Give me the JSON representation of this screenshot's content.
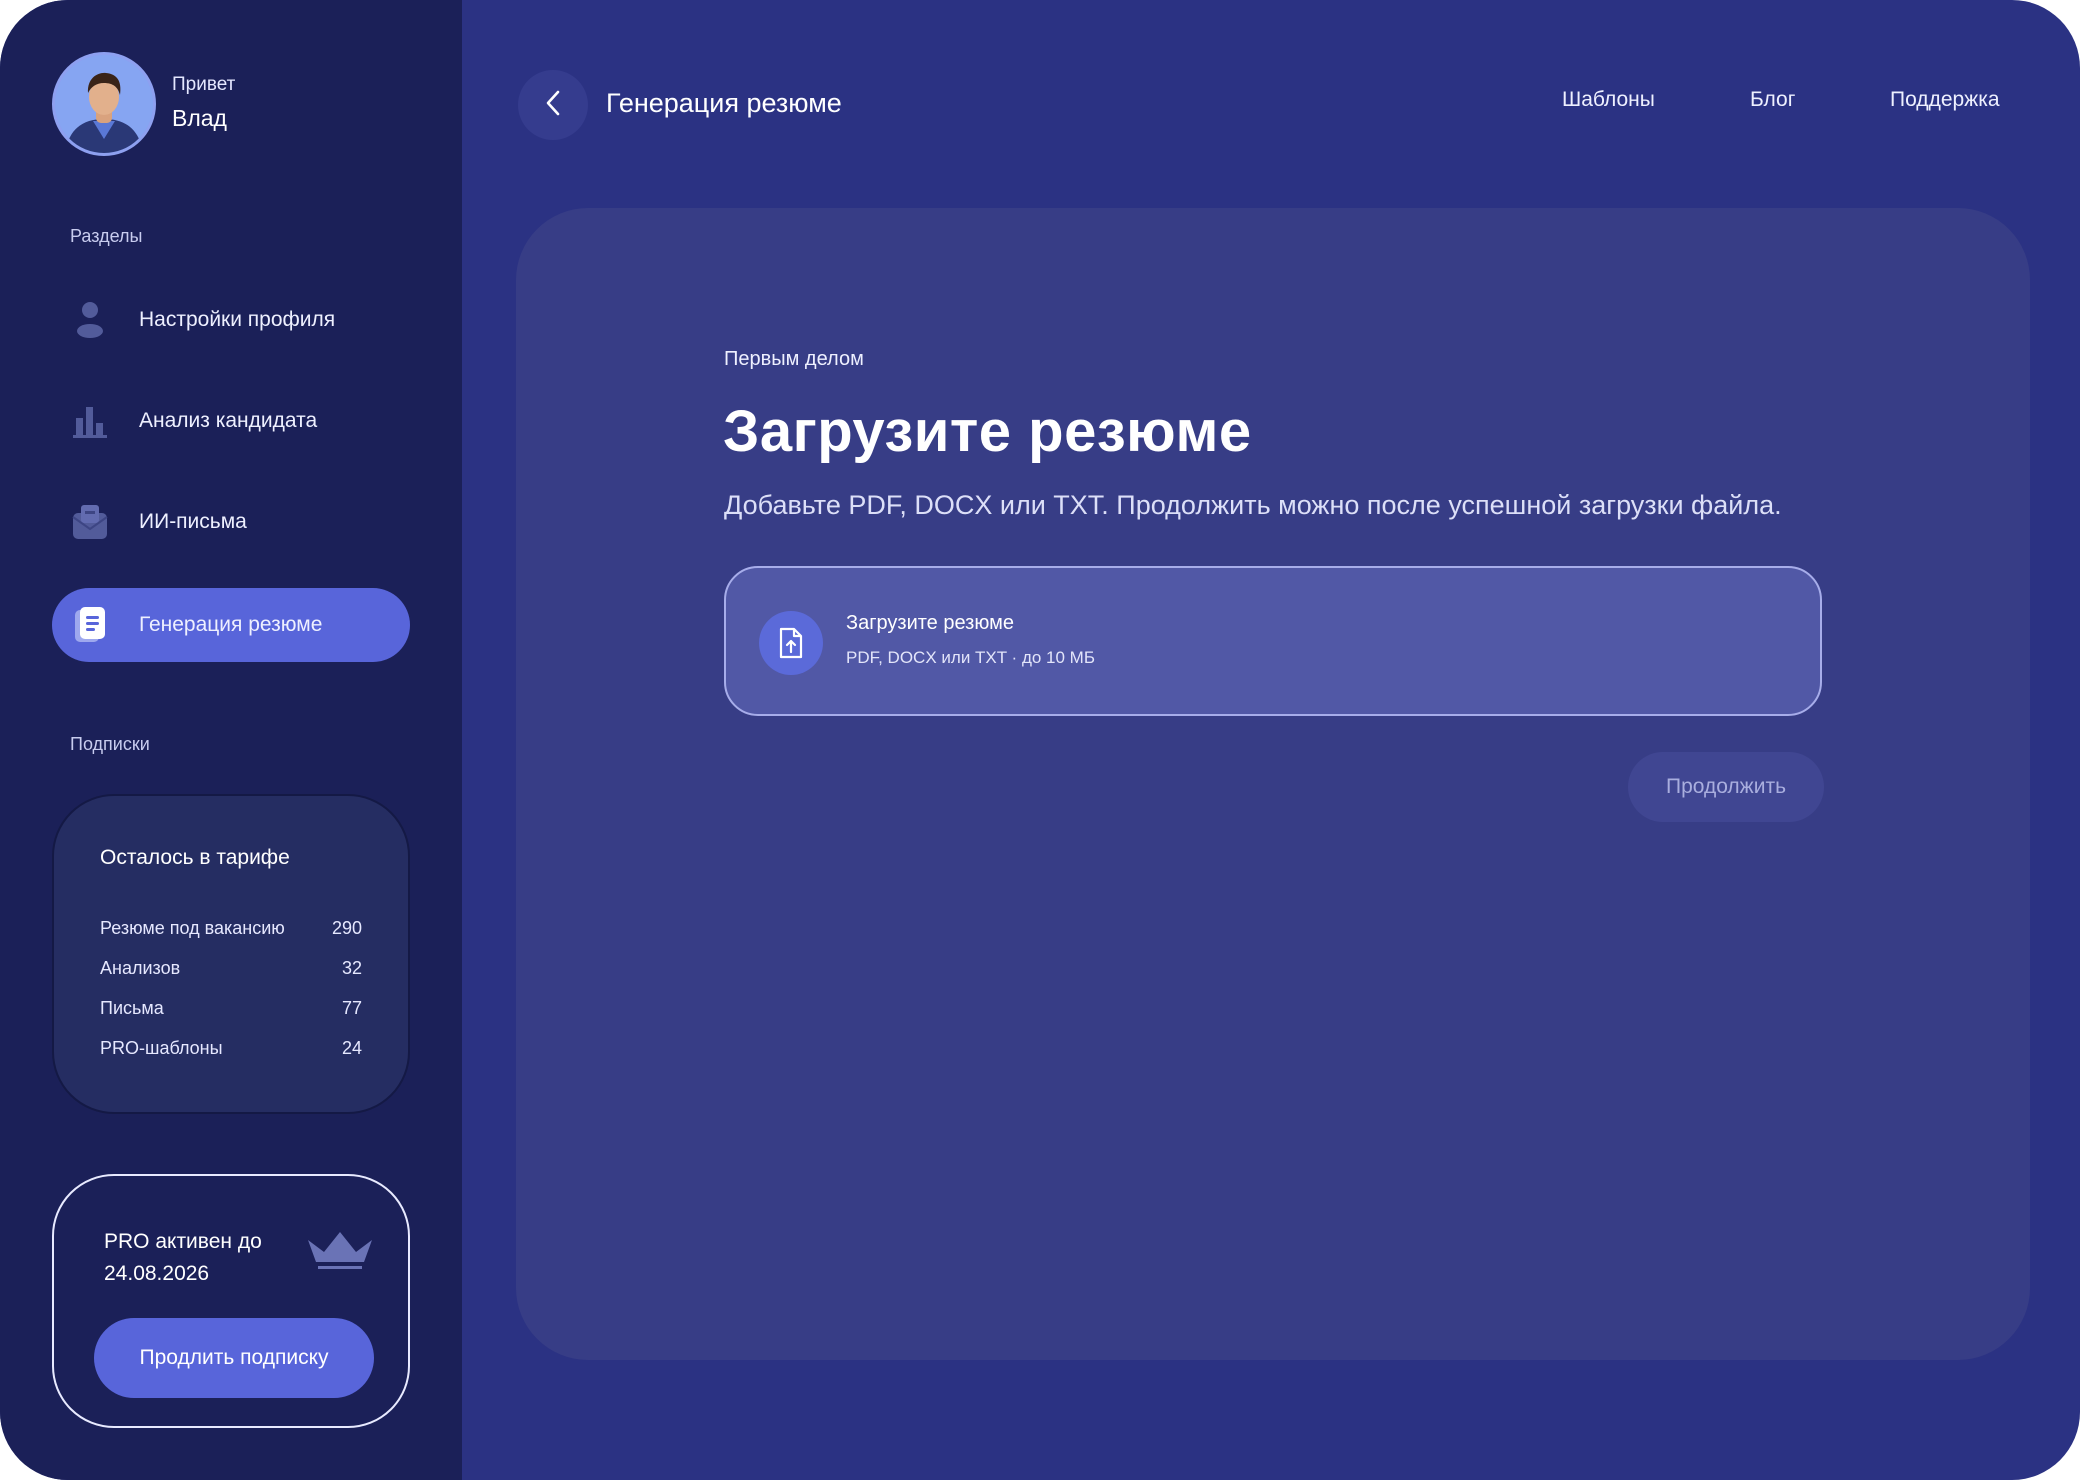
{
  "user": {
    "greeting": "Привет",
    "name": "Влад"
  },
  "sidebar": {
    "sections_label": "Разделы",
    "items": [
      {
        "label": "Настройки профиля",
        "icon": "user-icon"
      },
      {
        "label": "Анализ кандидата",
        "icon": "bar-chart-icon"
      },
      {
        "label": "ИИ-письма",
        "icon": "mail-icon"
      },
      {
        "label": "Генерация резюме",
        "icon": "document-icon",
        "active": true
      }
    ],
    "subscriptions_label": "Подписки",
    "tariff": {
      "title": "Осталось в тарифе",
      "rows": [
        {
          "label": "Резюме под вакансию",
          "value": "290"
        },
        {
          "label": "Анализов",
          "value": "32"
        },
        {
          "label": "Письма",
          "value": "77"
        },
        {
          "label": "PRO-шаблоны",
          "value": "24"
        }
      ]
    },
    "pro": {
      "line1": "PRO активен до",
      "line2": "24.08.2026",
      "icon": "crown-icon",
      "renew_label": "Продлить подписку"
    }
  },
  "header": {
    "title": "Генерация резюме",
    "nav": [
      "Шаблоны",
      "Блог",
      "Поддержка"
    ]
  },
  "main": {
    "eyebrow": "Первым делом",
    "title": "Загрузите резюме",
    "subtitle": "Добавьте PDF, DOCX или TXT. Продолжить можно после успешной загрузки файла.",
    "upload": {
      "title": "Загрузите резюме",
      "hint": "PDF, DOCX или TXT · до 10 МБ",
      "icon": "file-upload-icon"
    },
    "continue_label": "Продолжить"
  },
  "colors": {
    "background": "#2b3283",
    "sidebar": "#1b2058",
    "accent": "#5865da",
    "card": "#373d86"
  }
}
